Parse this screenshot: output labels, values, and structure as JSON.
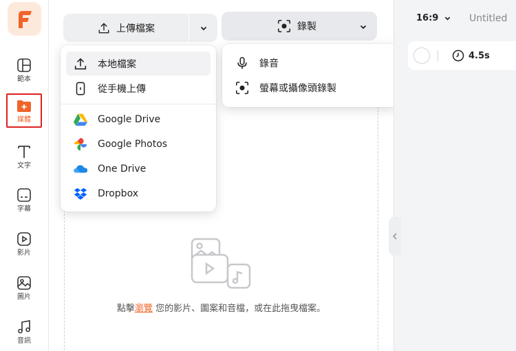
{
  "sidebar": {
    "items": [
      {
        "label": "範本",
        "icon": "template-icon"
      },
      {
        "label": "媒體",
        "icon": "media-folder-icon",
        "active": true
      },
      {
        "label": "文字",
        "icon": "text-icon"
      },
      {
        "label": "字幕",
        "icon": "subtitle-icon"
      },
      {
        "label": "影片",
        "icon": "video-icon"
      },
      {
        "label": "圖片",
        "icon": "image-icon"
      },
      {
        "label": "音訊",
        "icon": "music-icon"
      }
    ]
  },
  "toolbar": {
    "upload_label": "上傳檔案",
    "record_label": "錄製"
  },
  "upload_menu": {
    "local": "本地檔案",
    "phone": "從手機上傳",
    "google_drive": "Google Drive",
    "google_photos": "Google Photos",
    "one_drive": "One Drive",
    "dropbox": "Dropbox"
  },
  "record_menu": {
    "audio": "錄音",
    "screen": "螢幕或攝像頭錄製"
  },
  "dropzone": {
    "prefix": "點擊",
    "link": "瀏覽",
    "suffix": " 您的影片、圖案和音檔，或在此拖曳檔案。"
  },
  "right_panel": {
    "aspect_ratio": "16:9",
    "title": "Untitled",
    "duration": "4.5s"
  },
  "colors": {
    "accent": "#f0642b",
    "active_outline": "#e02020"
  }
}
